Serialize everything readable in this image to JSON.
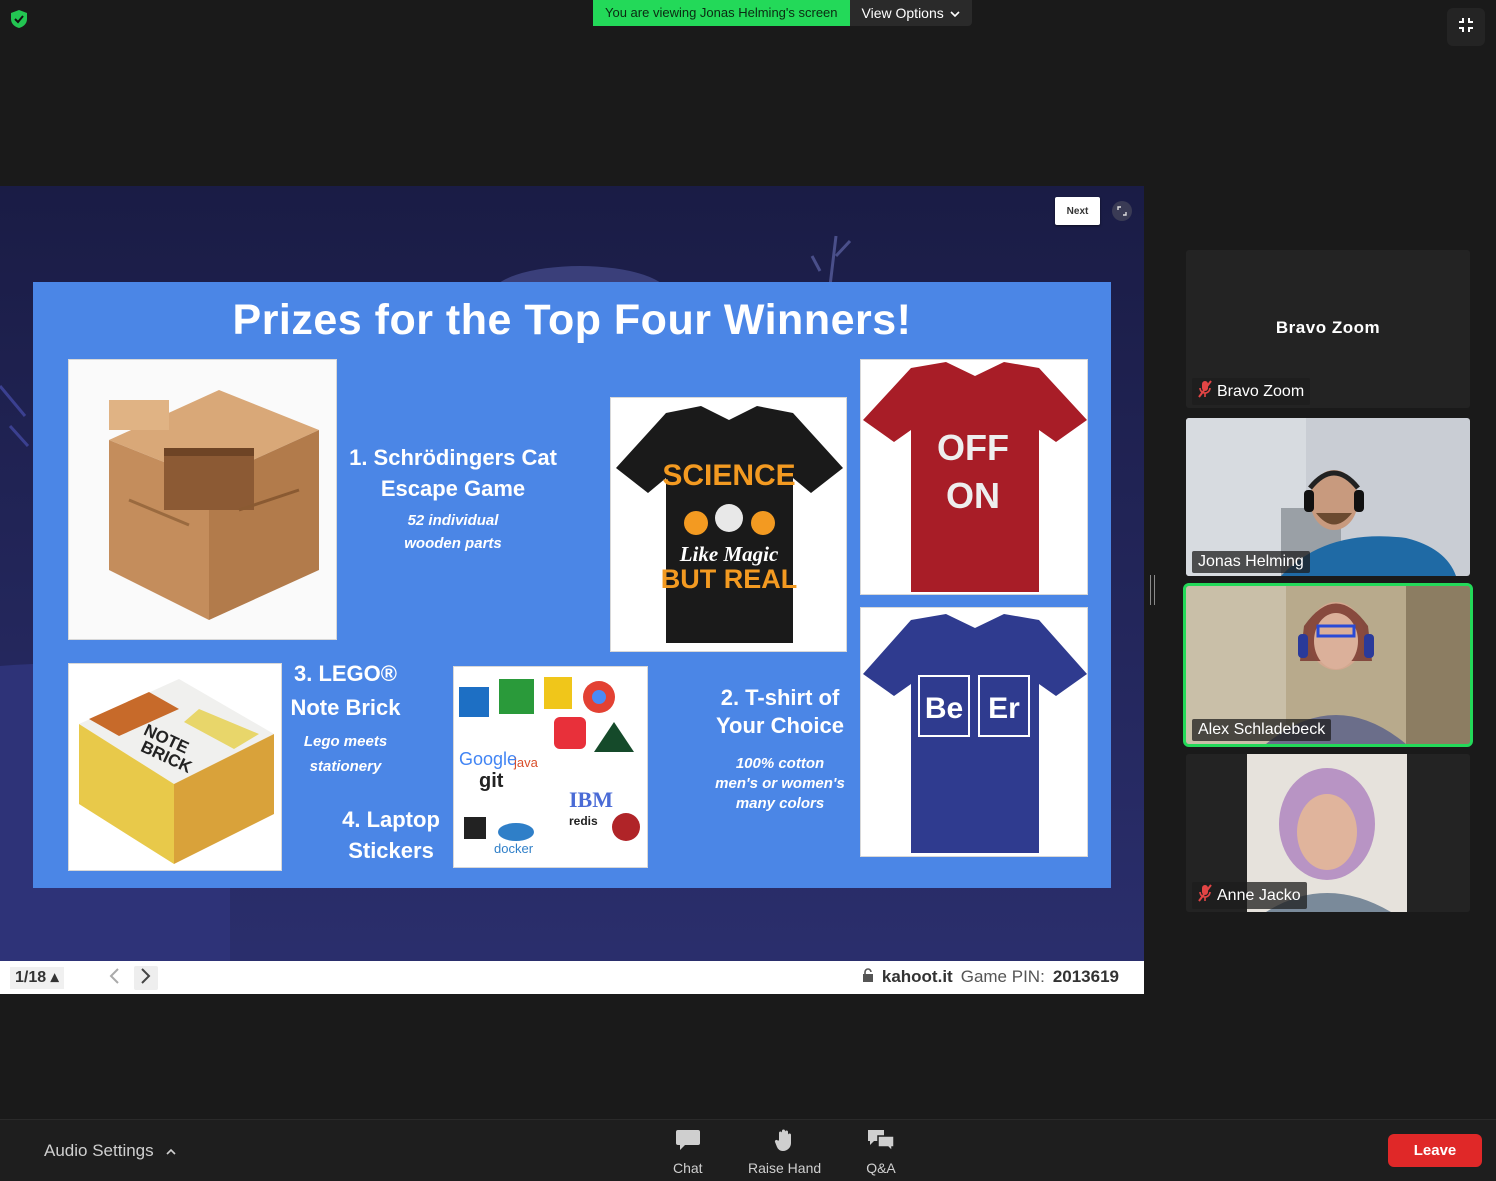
{
  "banner": {
    "viewing_text": "You are viewing Jonas Helming's screen",
    "view_options_label": "View Options"
  },
  "shared_screen": {
    "next_label": "Next",
    "slide": {
      "title": "Prizes for the Top Four Winners!",
      "prize1": {
        "line1": "1. Schrödingers Cat",
        "line2": "Escape Game",
        "detail1": "52 individual",
        "detail2": "wooden parts"
      },
      "prize2": {
        "line1": "2. T-shirt of",
        "line2": "Your Choice",
        "detail1": "100% cotton",
        "detail2": "men's or women's",
        "detail3": "many colors"
      },
      "prize3": {
        "line1": "3. LEGO®",
        "line2": "Note Brick",
        "detail1": "Lego meets",
        "detail2": "stationery"
      },
      "prize4": {
        "line1": "4. Laptop",
        "line2": "Stickers"
      },
      "shirt_black": {
        "line1": "SCIENCE",
        "line2": "Like Magic",
        "line3": "BUT REAL"
      },
      "shirt_red": {
        "line1": "OFF",
        "line2": "ON"
      },
      "shirt_blue": {
        "el1": "Be",
        "el2": "Er"
      },
      "lego_box": {
        "line1": "NOTE",
        "line2": "BRICK"
      },
      "stickers": {
        "s1": "Google",
        "s2": "git",
        "s3": "IBM",
        "s4": "docker",
        "s5": "redis",
        "s6": "java"
      }
    },
    "page_indicator": "1/18 ▴",
    "site": "kahoot.it",
    "pin_label": "Game PIN:",
    "pin_value": "2013619"
  },
  "participants": [
    {
      "center_name": "Bravo Zoom",
      "name": "Bravo Zoom",
      "muted": true
    },
    {
      "name": "Jonas Helming",
      "muted": false
    },
    {
      "name": "Alex Schladebeck",
      "muted": false,
      "active": true
    },
    {
      "name": "Anne Jacko",
      "muted": true
    }
  ],
  "toolbar": {
    "audio_settings_label": "Audio Settings",
    "chat_label": "Chat",
    "raise_hand_label": "Raise Hand",
    "qa_label": "Q&A",
    "leave_label": "Leave"
  },
  "colors": {
    "banner_green": "#23d959",
    "slide_blue": "#4b86e6",
    "leave_red": "#e02828",
    "active_speaker": "#23d959"
  }
}
